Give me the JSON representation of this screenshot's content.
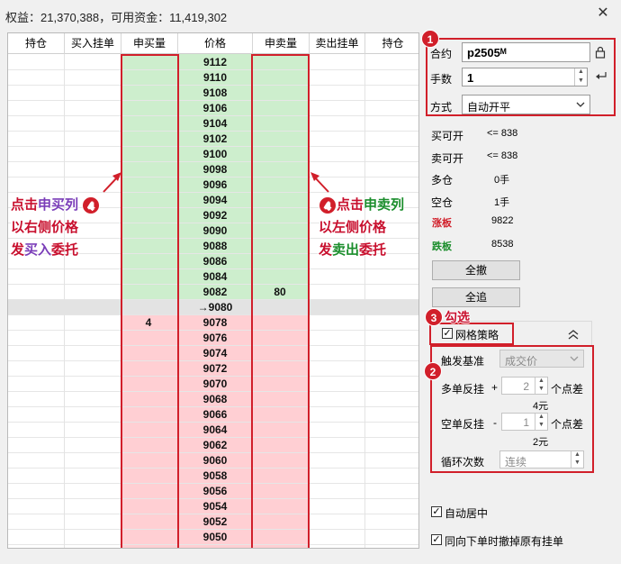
{
  "window": {
    "title": "权益：21,370,388，可用资金：11,419,302",
    "close": "✕"
  },
  "book": {
    "headers": [
      "持仓",
      "买入挂单",
      "申买量",
      "价格",
      "申卖量",
      "卖出挂单",
      "持仓"
    ],
    "ask_prices": [
      "9112",
      "9110",
      "9108",
      "9106",
      "9104",
      "9102",
      "9100",
      "9098",
      "9096",
      "9094",
      "9092",
      "9090",
      "9088",
      "9086",
      "9084",
      "9082"
    ],
    "ask_volume_at_9082": "80",
    "last_price": "→9080",
    "bid_prices": [
      "9078",
      "9076",
      "9074",
      "9072",
      "9070",
      "9068",
      "9066",
      "9064",
      "9062",
      "9060",
      "9058",
      "9056",
      "9054",
      "9052",
      "9050"
    ],
    "bid_volume_at_9078": "4"
  },
  "annotations": {
    "left": {
      "badge": "4",
      "line1": "点击",
      "line1b": "申买列",
      "line2": "以右侧价格",
      "line3a": "发",
      "line3b": "买入",
      "line3c": "委托"
    },
    "right": {
      "badge": "4",
      "line1": "点击",
      "line1b": "申卖列",
      "line2": "以左侧价格",
      "line3a": "发",
      "line3b": "卖出",
      "line3c": "委托"
    },
    "badge1": "1",
    "badge2": "2",
    "badge3": "3",
    "check_label": "勾选"
  },
  "order_panel": {
    "contract_label": "合约",
    "contract_value": "p2505ᴹ",
    "qty_label": "手数",
    "qty_value": "1",
    "mode_label": "方式",
    "mode_value": "自动开平"
  },
  "info": {
    "buy_open_label": "买可开",
    "buy_open_value": "<= 838",
    "sell_open_label": "卖可开",
    "sell_open_value": "<= 838",
    "long_label": "多仓",
    "long_value": "0手",
    "short_label": "空仓",
    "short_value": "1手",
    "limit_up_label": "涨板",
    "limit_up_value": "9822",
    "limit_down_label": "跌板",
    "limit_down_value": "8538"
  },
  "buttons": {
    "cancel_all": "全撤",
    "chase_all": "全追"
  },
  "grid": {
    "enabled_label": "网格策略",
    "trigger_label": "触发基准",
    "trigger_value": "成交价",
    "long_label": "多单反挂",
    "long_sign": "+",
    "long_points": "2",
    "long_unit": "个点差",
    "long_amount": "4元",
    "short_label": "空单反挂",
    "short_sign": "-",
    "short_points": "1",
    "short_unit": "个点差",
    "short_amount": "2元",
    "loop_label": "循环次数",
    "loop_value": "连续"
  },
  "footer": {
    "auto_center": "自动居中",
    "cancel_same_dir": "同向下单时撤掉原有挂单"
  },
  "colors": {
    "ask_bg": "#cdeecd",
    "bid_bg": "#ffcfd3",
    "highlight": "#d11f2a"
  }
}
